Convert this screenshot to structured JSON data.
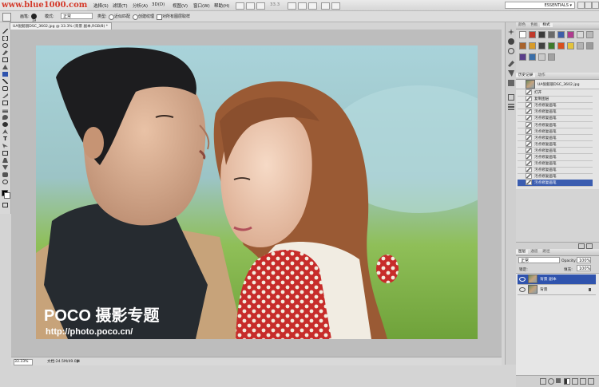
{
  "watermark_top": "www.blue1000.com",
  "menu": [
    "选择(S)",
    "滤镜(T)",
    "分析(A)",
    "3D(D)",
    "视图(V)",
    "窗口(W)",
    "帮助(H)"
  ],
  "zoom_display": "33.3",
  "workspace": "ESSENTIALS ▾",
  "options": {
    "brush_label": "画笔:",
    "brush_size": "19",
    "mode_label": "模式:",
    "mode_value": "正常",
    "type_label": "类型:",
    "content_aware": "近似匹配",
    "create_texture": "创建纹理",
    "sample_all": "对所有图层取样"
  },
  "document_tab": "UA倪懿丽DSC_3602.jpg @ 33.3% (背景 副本,RGB/8) *",
  "status": {
    "zoom": "33.33%",
    "doc": "文档:24.5M/49.0M"
  },
  "photo": {
    "watermark_logo": "POCO 摄影专题",
    "watermark_url": "http://photo.poco.cn/"
  },
  "styles_panel": {
    "tabs": [
      "颜色",
      "色板",
      "样式"
    ],
    "swatch_colors": [
      "#ffffff",
      "#c0392b",
      "#3a3a3a",
      "#6a6a6a",
      "#3d5ea8",
      "#b03b8f",
      "#d9d9d9",
      "#b8b8b8",
      "#a9632c",
      "#d89b2a",
      "#414141",
      "#3e7a2c",
      "#d84f1d",
      "#e3c33c",
      "#b2b2b2",
      "#9a9a9a",
      "#5a3d8a",
      "#3a6ea8",
      "#c9c9c9",
      "#a2a2a2"
    ]
  },
  "history_panel": {
    "tabs": [
      "历史记录",
      "动作"
    ],
    "snapshot": "UA倪懿丽DSC_3602.jpg",
    "items": [
      "打开",
      "复制图层",
      "污点修复画笔",
      "污点修复画笔",
      "污点修复画笔",
      "污点修复画笔",
      "污点修复画笔",
      "污点修复画笔",
      "污点修复画笔",
      "污点修复画笔",
      "污点修复画笔",
      "污点修复画笔",
      "污点修复画笔",
      "污点修复画笔",
      "污点修复画笔"
    ]
  },
  "layers_panel": {
    "tabs": [
      "图层",
      "通道",
      "路径"
    ],
    "blend_mode": "正常",
    "opacity_label": "Opacity:",
    "opacity_value": "100%",
    "lock_label": "锁定:",
    "fill_label": "填充:",
    "fill_value": "100%",
    "layers": [
      "背景 副本",
      "背景"
    ]
  }
}
